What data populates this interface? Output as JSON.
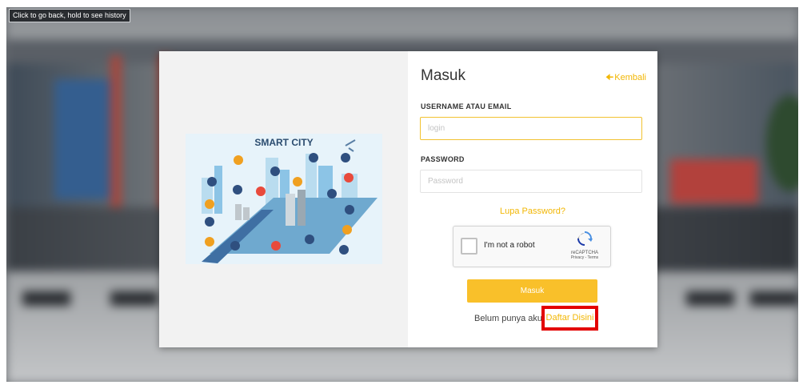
{
  "browser": {
    "back_tooltip": "Click to go back, hold to see history"
  },
  "left_panel": {
    "illustration_title": "SMART CITY"
  },
  "login": {
    "title": "Masuk",
    "back_label": "Kembali",
    "username_label": "USERNAME ATAU EMAIL",
    "username_placeholder": "login",
    "password_label": "PASSWORD",
    "password_placeholder": "Password",
    "forgot_password": "Lupa Password?",
    "captcha": {
      "label": "I'm not a robot",
      "brand": "reCAPTCHA",
      "links": "Privacy - Terms"
    },
    "submit_label": "Masuk",
    "signup_prompt": "Belum punya akun",
    "signup_link": "Daftar Disini"
  },
  "colors": {
    "accent": "#f9c02a",
    "highlight": "#e30000"
  }
}
